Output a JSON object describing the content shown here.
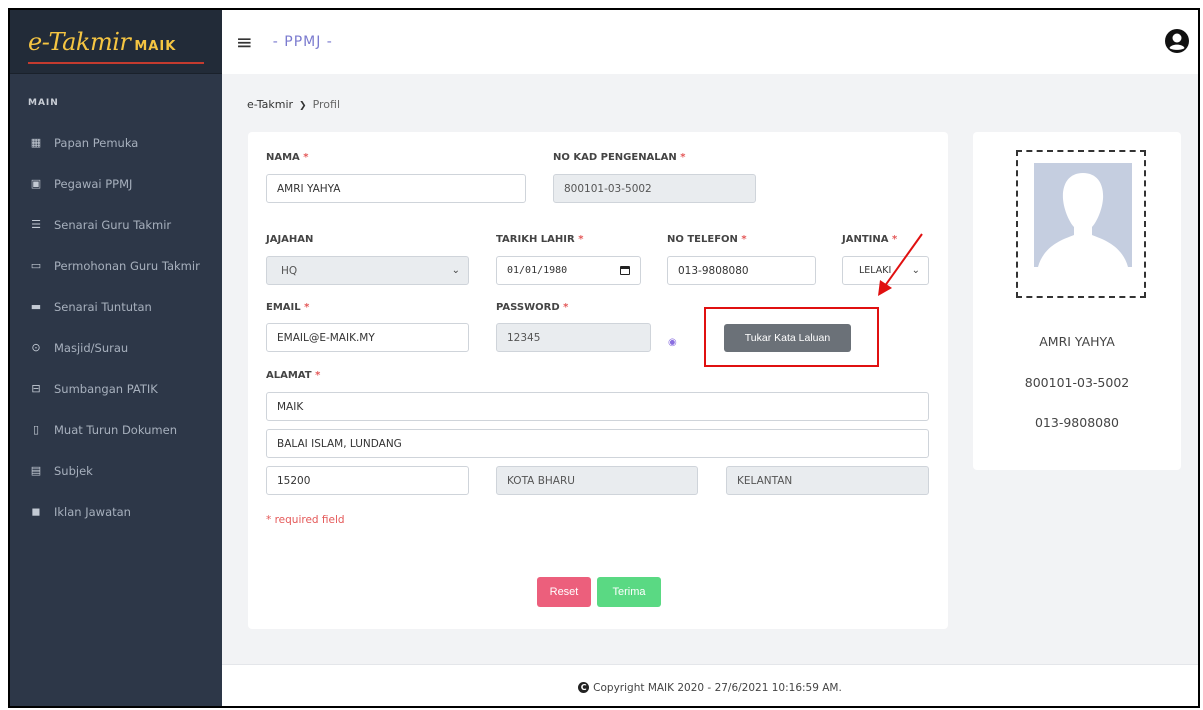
{
  "sidebar": {
    "logo_main": "e-Takmir",
    "logo_sub": "MAIK",
    "section": "MAIN",
    "items": [
      {
        "label": "Papan Pemuka"
      },
      {
        "label": "Pegawai PPMJ"
      },
      {
        "label": "Senarai Guru Takmir"
      },
      {
        "label": "Permohonan Guru Takmir"
      },
      {
        "label": "Senarai Tuntutan"
      },
      {
        "label": "Masjid/Surau"
      },
      {
        "label": "Sumbangan PATIK"
      },
      {
        "label": "Muat Turun Dokumen"
      },
      {
        "label": "Subjek"
      },
      {
        "label": "Iklan Jawatan"
      }
    ]
  },
  "topbar": {
    "title": "- PPMJ -"
  },
  "breadcrumb": {
    "root": "e-Takmir",
    "current": "Profil"
  },
  "form": {
    "nama": {
      "label": "NAMA",
      "value": "AMRI YAHYA"
    },
    "ic": {
      "label": "NO KAD PENGENALAN",
      "value": "800101-03-5002"
    },
    "jajahan": {
      "label": "JAJAHAN",
      "value": "HQ"
    },
    "tarikh": {
      "label": "TARIKH LAHIR",
      "value": "01/01/1980"
    },
    "telefon": {
      "label": "NO TELEFON",
      "value": "013-9808080"
    },
    "jantina": {
      "label": "JANTINA",
      "value": "LELAKI"
    },
    "email": {
      "label": "EMAIL",
      "value": "EMAIL@E-MAIK.MY"
    },
    "password": {
      "label": "PASSWORD",
      "value": "12345"
    },
    "change_password_label": "Tukar Kata Laluan",
    "alamat": {
      "label": "ALAMAT",
      "line1": "MAIK",
      "line2": "BALAI ISLAM, LUNDANG",
      "poskod": "15200",
      "bandar": "KOTA BHARU",
      "negeri": "KELANTAN"
    },
    "required_note": "* required field",
    "reset_label": "Reset",
    "accept_label": "Terima",
    "required_mark": "*"
  },
  "profile": {
    "name": "AMRI YAHYA",
    "ic": "800101-03-5002",
    "phone": "013-9808080"
  },
  "footer": {
    "text": "Copyright MAIK 2020 - 27/6/2021 10:16:59 AM."
  },
  "colors": {
    "sidebar_bg": "#2d3748",
    "highlight_red": "#e01010",
    "reset": "#ec5f7c",
    "accept": "#5ad983"
  }
}
